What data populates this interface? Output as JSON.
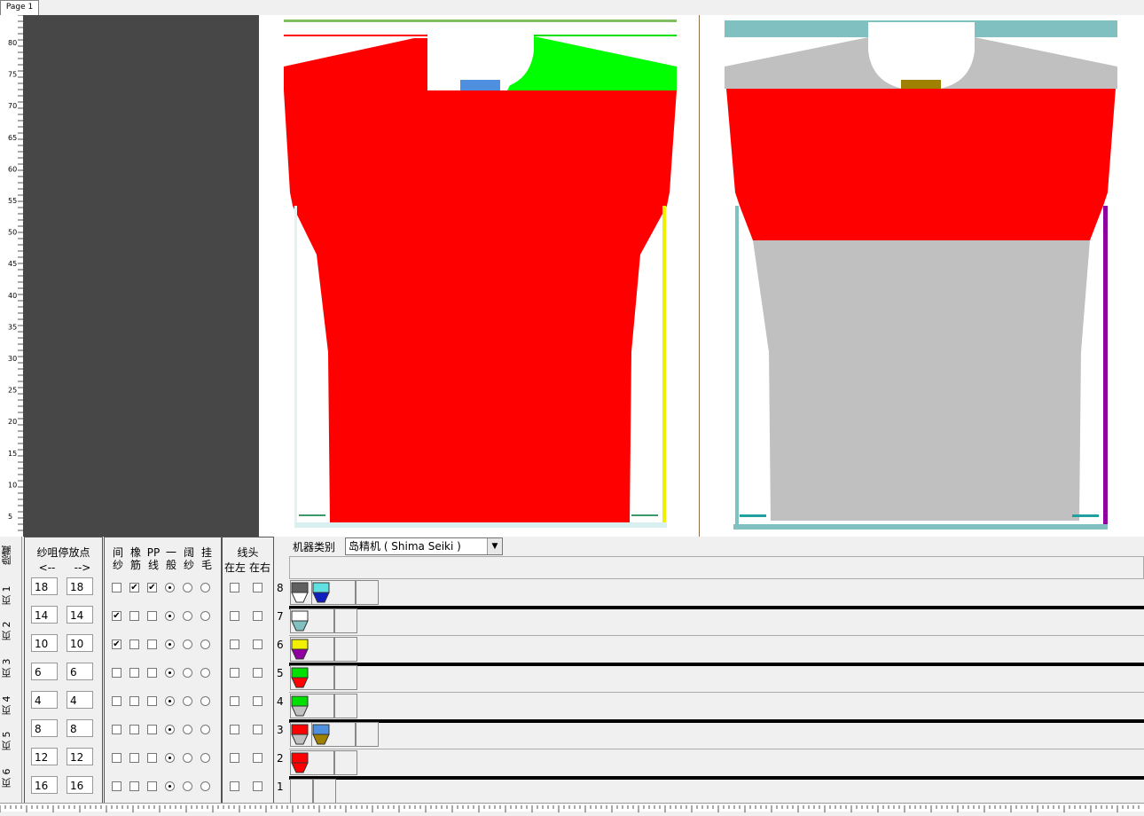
{
  "tabs": {
    "page1": "Page 1"
  },
  "ruler": {
    "ticks": [
      "80",
      "75",
      "70",
      "65",
      "60",
      "55",
      "50",
      "45",
      "40",
      "35",
      "30",
      "25",
      "20",
      "15",
      "10",
      "5"
    ]
  },
  "colors": {
    "red": "#ff0000",
    "green": "#00ff00",
    "gray": "#c0c0c0",
    "teal": "#80c0c0",
    "blue": "#4f8fdf",
    "olive": "#a08000",
    "yellow": "#f0f000",
    "purple": "#9000a0"
  },
  "sidebar": {
    "tabs": [
      "隐藏",
      "页 1",
      "页 2",
      "页 3",
      "页 4",
      "页 5",
      "页 6"
    ]
  },
  "yarn_stop": {
    "title": "纱咀停放点",
    "left": "<--",
    "right": "-->",
    "rows": [
      [
        "18",
        "18"
      ],
      [
        "14",
        "14"
      ],
      [
        "10",
        "10"
      ],
      [
        "6",
        "6"
      ],
      [
        "4",
        "4"
      ],
      [
        "8",
        "8"
      ],
      [
        "12",
        "12"
      ],
      [
        "16",
        "16"
      ]
    ]
  },
  "types": {
    "headers": [
      [
        "间",
        "纱"
      ],
      [
        "橡",
        "筋"
      ],
      [
        "PP",
        "线"
      ],
      [
        "一",
        "般"
      ],
      [
        "阔",
        "纱"
      ],
      [
        "挂",
        "毛"
      ]
    ]
  },
  "thread": {
    "title": "线头",
    "left": "在左",
    "right": "在右"
  },
  "machine": {
    "label": "机器类别",
    "value": "岛精机 ( Shima Seiki )"
  },
  "rows": [
    "8",
    "7",
    "6",
    "5",
    "4",
    "3",
    "2",
    "1"
  ]
}
